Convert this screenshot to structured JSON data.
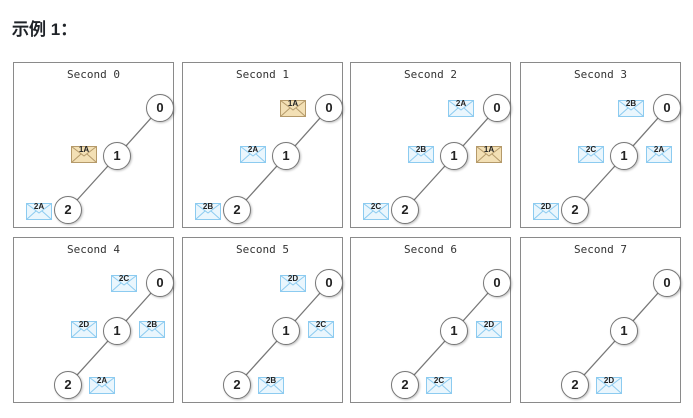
{
  "heading": "示例 1：",
  "colors": {
    "tan_fill": "#f3e0b5",
    "tan_stroke": "#b59a6a",
    "blue_fill": "#eaf6fd",
    "blue_stroke": "#8ccbf0"
  },
  "nodes": [
    "0",
    "1",
    "2"
  ],
  "panels": [
    {
      "title": "Second 0",
      "messages": [
        {
          "label": "1A",
          "slot": "left-1",
          "color": "tan"
        },
        {
          "label": "2A",
          "slot": "left-2",
          "color": "blue"
        }
      ]
    },
    {
      "title": "Second 1",
      "messages": [
        {
          "label": "1A",
          "slot": "left-0",
          "color": "tan"
        },
        {
          "label": "2A",
          "slot": "left-1",
          "color": "blue"
        },
        {
          "label": "2B",
          "slot": "left-2",
          "color": "blue"
        }
      ]
    },
    {
      "title": "Second 2",
      "messages": [
        {
          "label": "2A",
          "slot": "left-0",
          "color": "blue"
        },
        {
          "label": "2B",
          "slot": "left-1",
          "color": "blue"
        },
        {
          "label": "1A",
          "slot": "right-1",
          "color": "tan"
        },
        {
          "label": "2C",
          "slot": "left-2",
          "color": "blue"
        }
      ]
    },
    {
      "title": "Second 3",
      "messages": [
        {
          "label": "2B",
          "slot": "left-0",
          "color": "blue"
        },
        {
          "label": "2C",
          "slot": "left-1",
          "color": "blue"
        },
        {
          "label": "2A",
          "slot": "right-1",
          "color": "blue"
        },
        {
          "label": "2D",
          "slot": "left-2",
          "color": "blue"
        }
      ]
    },
    {
      "title": "Second 4",
      "messages": [
        {
          "label": "2C",
          "slot": "left-0",
          "color": "blue"
        },
        {
          "label": "2D",
          "slot": "left-1",
          "color": "blue"
        },
        {
          "label": "2B",
          "slot": "right-1",
          "color": "blue"
        },
        {
          "label": "2A",
          "slot": "right-2",
          "color": "blue"
        }
      ]
    },
    {
      "title": "Second 5",
      "messages": [
        {
          "label": "2D",
          "slot": "left-0",
          "color": "blue"
        },
        {
          "label": "2C",
          "slot": "right-1",
          "color": "blue"
        },
        {
          "label": "2B",
          "slot": "right-2",
          "color": "blue"
        }
      ]
    },
    {
      "title": "Second 6",
      "messages": [
        {
          "label": "2D",
          "slot": "right-1",
          "color": "blue"
        },
        {
          "label": "2C",
          "slot": "right-2",
          "color": "blue"
        }
      ]
    },
    {
      "title": "Second 7",
      "messages": [
        {
          "label": "2D",
          "slot": "right-2",
          "color": "blue"
        }
      ]
    }
  ]
}
